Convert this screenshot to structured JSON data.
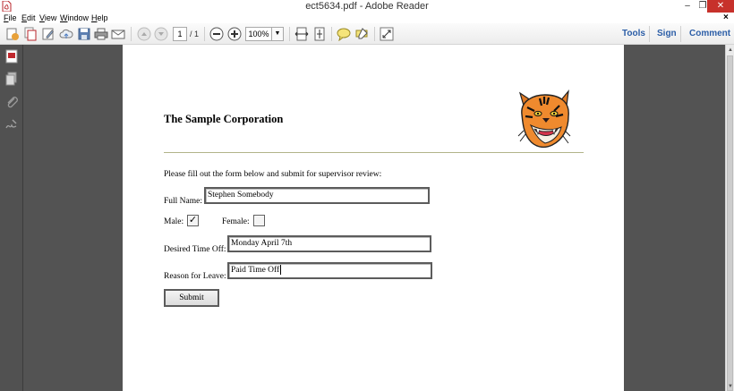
{
  "window": {
    "title": "ect5634.pdf - Adobe Reader",
    "minimize": "–",
    "maximize": "❐",
    "close": "✕"
  },
  "menu": {
    "items": [
      "File",
      "Edit",
      "View",
      "Window",
      "Help"
    ],
    "close_doc": "×"
  },
  "toolbar": {
    "page_current": "1",
    "page_total": "/ 1",
    "zoom": "100%",
    "zoom_dropdown": "▼",
    "links": [
      "Tools",
      "Sign",
      "Comment"
    ]
  },
  "scrollbar": {
    "up": "▲",
    "down": "▼"
  },
  "document": {
    "company": "The Sample Corporation",
    "intro": "Please fill out the form below and submit for supervisor review:",
    "full_name_label": "Full Name:",
    "full_name_value": "Stephen Somebody",
    "male_label": "Male:",
    "male_checked": "✓",
    "female_label": "Female:",
    "time_off_label": "Desired Time Off:",
    "time_off_value": "Monday April 7th",
    "reason_label": "Reason for Leave:",
    "reason_value": "Paid Time Off",
    "submit_label": "Submit"
  },
  "icons": {
    "app": "pdf-file-icon",
    "toolbar": [
      "create-pdf-icon",
      "combine-icon",
      "edit-icon",
      "cloud-upload-icon",
      "save-icon",
      "print-icon",
      "email-icon",
      "previous-page-icon",
      "next-page-icon",
      "zoom-out-icon",
      "zoom-in-icon",
      "fit-width-icon",
      "fit-page-icon",
      "comment-icon",
      "highlight-icon",
      "read-mode-icon"
    ],
    "nav": [
      "pdf-page-icon",
      "pages-icon",
      "attachment-icon",
      "signature-icon"
    ]
  },
  "colors": {
    "close_button": "#c7312b",
    "link": "#2c5ea7",
    "doc_background": "#535353",
    "rule": "#b2b48a"
  }
}
